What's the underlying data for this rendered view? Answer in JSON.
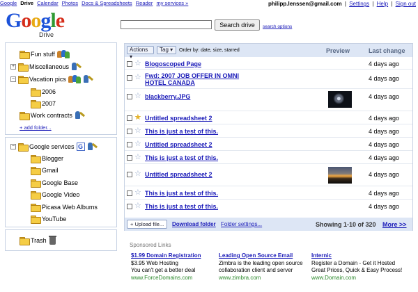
{
  "topnav": {
    "items": [
      "Google",
      "Drive",
      "Calendar",
      "Photos",
      "Docs & Spreadsheets",
      "Reader",
      "my services »"
    ],
    "current": "Drive"
  },
  "account": {
    "user": "philipp.lenssen@gmail.com",
    "settings": "Settings",
    "help": "Help",
    "signout": "Sign out"
  },
  "logo": {
    "letters": [
      "G",
      "o",
      "o",
      "g",
      "l",
      "e"
    ],
    "product": "Drive"
  },
  "search": {
    "value": "",
    "button": "Search drive",
    "options": "search options"
  },
  "sidebar": {
    "folders": [
      {
        "label": "Fun stuff"
      },
      {
        "label": "Miscellaneous",
        "expander": "+"
      },
      {
        "label": "Vacation pics",
        "expander": "−"
      },
      {
        "label": "2006"
      },
      {
        "label": "2007"
      },
      {
        "label": "Work contracts"
      }
    ],
    "add_folder": "+ add folder...",
    "services_root": {
      "label": "Google services",
      "expander": "−",
      "badge": "G"
    },
    "services": [
      "Blogger",
      "Gmail",
      "Google Base",
      "Google Video",
      "Picasa Web Albums",
      "YouTube"
    ],
    "trash": "Trash"
  },
  "list": {
    "actions_label": "Actions ▾",
    "tag_label": "Tag ▾",
    "sort_label": "Order by: date, size, starred",
    "col_preview": "Preview",
    "col_last_change": "Last change",
    "rows": [
      {
        "name": "Blogoscoped Page",
        "date": "4 days ago",
        "starred": false
      },
      {
        "name": "Fwd: 2007 JOB OFFER IN OMNI HOTEL CANADA",
        "date": "4 days ago",
        "starred": false
      },
      {
        "name": "blackberry.JPG",
        "date": "4 days ago",
        "starred": false
      },
      {
        "name": "Untitled spreadsheet 2",
        "date": "4 days ago",
        "starred": true
      },
      {
        "name": "This is just a test of this.",
        "date": "4 days ago",
        "starred": false
      },
      {
        "name": "Untitled spreadsheet 2",
        "date": "4 days ago",
        "starred": false
      },
      {
        "name": "This is just a test of this.",
        "date": "4 days ago",
        "starred": false
      },
      {
        "name": "Untitled spreadsheet 2",
        "date": "4 days ago",
        "starred": false
      },
      {
        "name": "This is just a test of this.",
        "date": "4 days ago",
        "starred": false
      },
      {
        "name": "This is just a test of this.",
        "date": "4 days ago",
        "starred": false
      }
    ],
    "upload_label": "+ Upload file...",
    "download_folder": "Download folder",
    "folder_settings": "Folder settings...",
    "showing": "Showing 1-10 of 320",
    "more": "More >>"
  },
  "sponsored": {
    "title": "Sponsored Links",
    "ads": [
      {
        "title": "$1.99 Domain Registration",
        "line1": "$3.95 Web Hosting",
        "line2": "You can't get a better deal",
        "url": "www.ForceDomains.com"
      },
      {
        "title": "Leading Open Source Email",
        "line1": "Zimbra is the leading open source",
        "line2": "collaboration client and server",
        "url": "www.zimbra.com"
      },
      {
        "title": "Internic",
        "line1": "Register a Domain - Get it Hosted",
        "line2": "Great Prices, Quick & Easy Process!",
        "url": "www.Domain.com"
      }
    ]
  },
  "colors": {
    "link": "#1a1ab8",
    "panel_header": "#dde6f5",
    "panel_border": "#c6d1e3",
    "ad_url": "#2d8a2d"
  }
}
